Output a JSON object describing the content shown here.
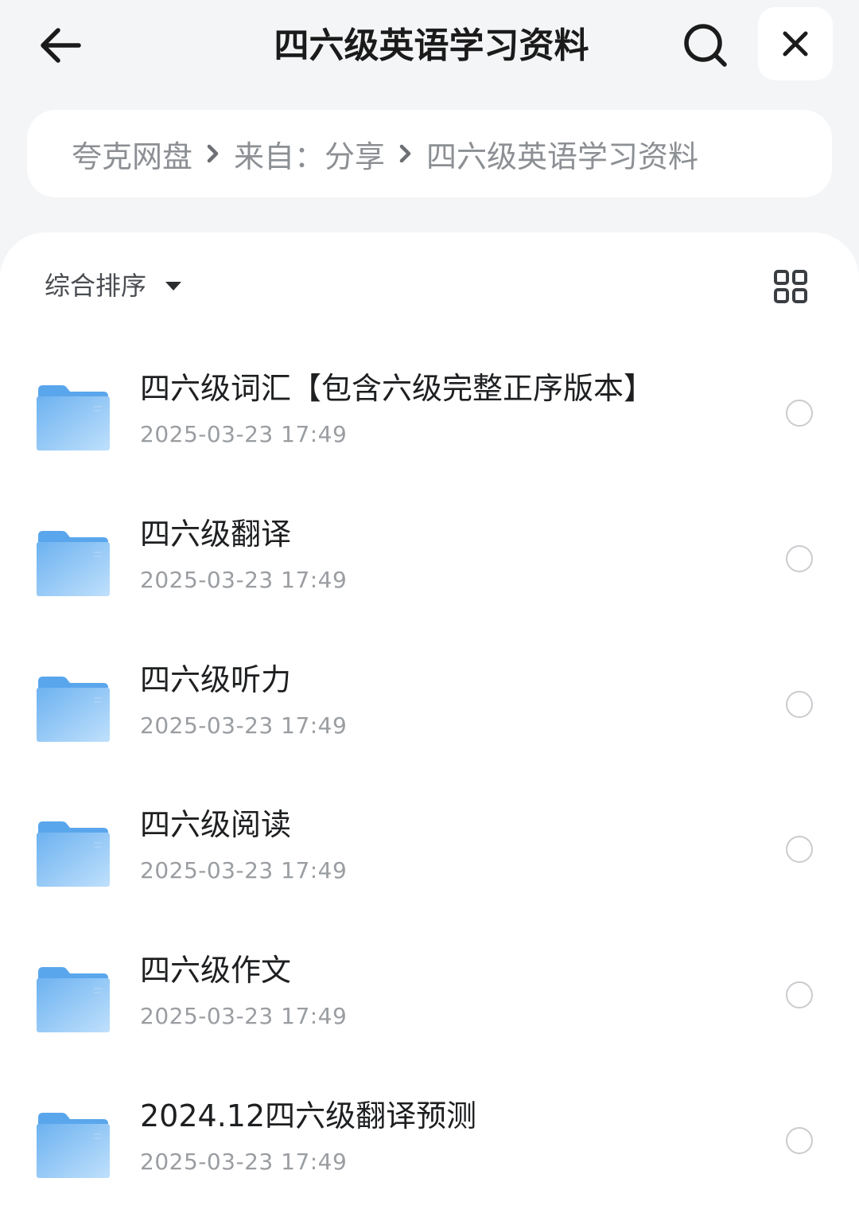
{
  "header": {
    "title": "四六级英语学习资料",
    "back_icon": "arrow-left-icon",
    "search_icon": "search-icon",
    "close_icon": "close-icon"
  },
  "breadcrumb": {
    "items": [
      "夸克网盘",
      "来自：分享",
      "四六级英语学习资料"
    ],
    "separator_icon": "chevron-right-icon"
  },
  "toolbar": {
    "sort_label": "综合排序",
    "sort_caret_icon": "caret-down-icon",
    "view_toggle_icon": "grid-view-icon"
  },
  "files": [
    {
      "name": "四六级词汇【包含六级完整正序版本】",
      "date": "2025-03-23 17:49",
      "icon": "folder-icon"
    },
    {
      "name": "四六级翻译",
      "date": "2025-03-23 17:49",
      "icon": "folder-icon"
    },
    {
      "name": "四六级听力",
      "date": "2025-03-23 17:49",
      "icon": "folder-icon"
    },
    {
      "name": "四六级阅读",
      "date": "2025-03-23 17:49",
      "icon": "folder-icon"
    },
    {
      "name": "四六级作文",
      "date": "2025-03-23 17:49",
      "icon": "folder-icon"
    },
    {
      "name": "2024.12四六级翻译预测",
      "date": "2025-03-23 17:49",
      "icon": "folder-icon"
    }
  ],
  "colors": {
    "page_bg": "#f4f5f6",
    "card_bg": "#ffffff",
    "folder_light": "#b9dcfb",
    "folder_dark": "#5aa6ec",
    "muted_text": "#9a9da1"
  }
}
